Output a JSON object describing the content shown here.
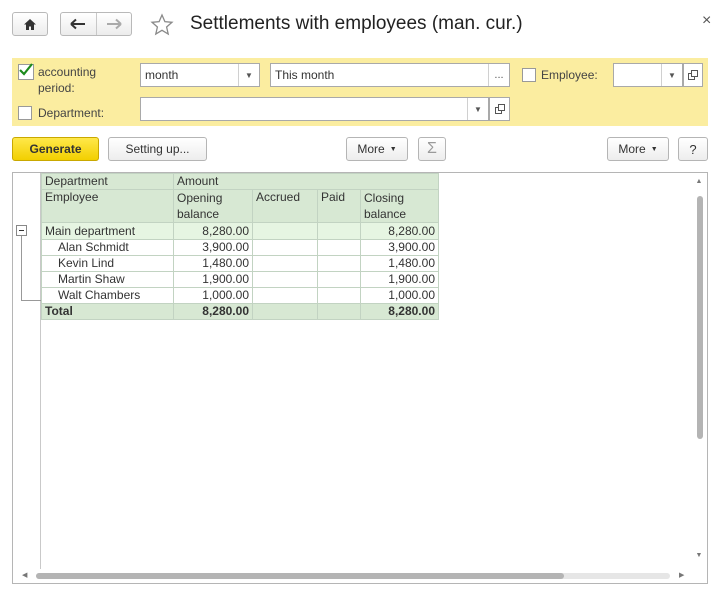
{
  "window": {
    "title": "Settlements with employees (man. cur.)",
    "close": "×"
  },
  "filters": {
    "period_label": "accounting period:",
    "period_type": "month",
    "period_value": "This month",
    "period_dots": "...",
    "employee_label": "Employee:",
    "employee_value": "",
    "department_label": "Department:",
    "department_value": ""
  },
  "toolbar": {
    "generate": "Generate",
    "setting_up": "Setting up...",
    "more_left": "More",
    "more_right": "More",
    "help": "?"
  },
  "report": {
    "header": {
      "department": "Department",
      "employee": "Employee",
      "amount": "Amount",
      "opening": "Opening balance",
      "accrued": "Accrued",
      "paid": "Paid",
      "closing": "Closing balance"
    },
    "group": {
      "name": "Main department",
      "opening": "8,280.00",
      "accrued": "",
      "paid": "",
      "closing": "8,280.00"
    },
    "rows": [
      {
        "name": "Alan Schmidt",
        "opening": "3,900.00",
        "accrued": "",
        "paid": "",
        "closing": "3,900.00"
      },
      {
        "name": "Kevin Lind",
        "opening": "1,480.00",
        "accrued": "",
        "paid": "",
        "closing": "1,480.00"
      },
      {
        "name": "Martin Shaw",
        "opening": "1,900.00",
        "accrued": "",
        "paid": "",
        "closing": "1,900.00"
      },
      {
        "name": "Walt Chambers",
        "opening": "1,000.00",
        "accrued": "",
        "paid": "",
        "closing": "1,000.00"
      }
    ],
    "total": {
      "name": "Total",
      "opening": "8,280.00",
      "accrued": "",
      "paid": "",
      "closing": "8,280.00"
    }
  }
}
